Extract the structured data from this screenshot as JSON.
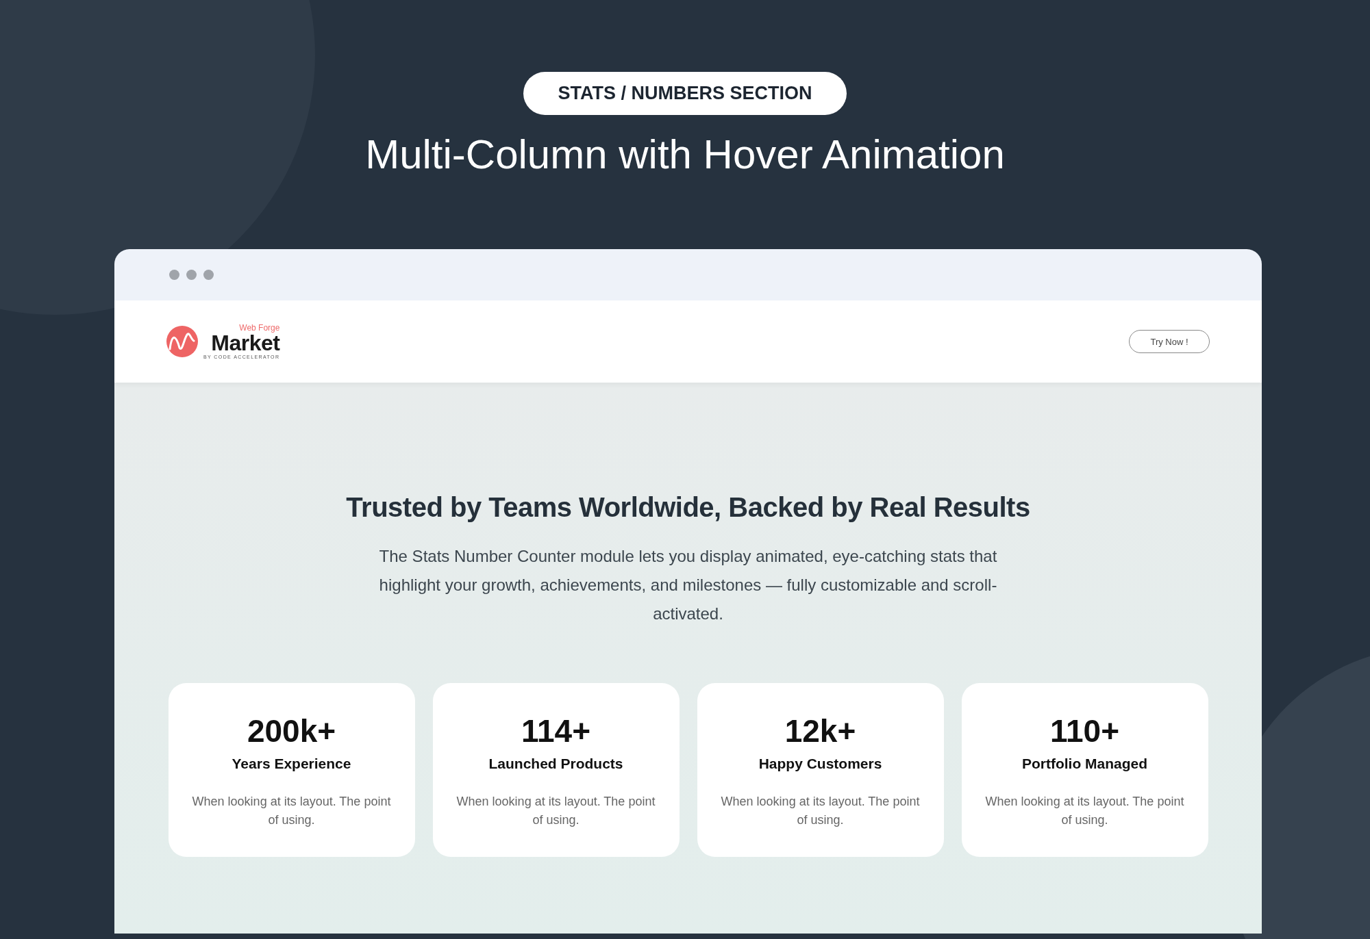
{
  "badge": "STATS / NUMBERS SECTION",
  "headline": "Multi-Column with Hover Animation",
  "browser": {
    "nav": {
      "logo": {
        "tagline": "Web Forge",
        "name": "Market",
        "byline": "BY CODE ACCELERATOR"
      },
      "button": "Try Now !"
    },
    "section": {
      "heading": "Trusted by Teams Worldwide, Backed by Real Results",
      "description": "The Stats Number Counter module lets you display animated, eye-catching stats that highlight your growth, achievements, and milestones — fully customizable and scroll-activated.",
      "stats": [
        {
          "value": "200k+",
          "label": "Years Experience",
          "text": "When looking at its layout. The point of using."
        },
        {
          "value": "114+",
          "label": "Launched Products",
          "text": "When looking at its layout. The point of using."
        },
        {
          "value": "12k+",
          "label": "Happy Customers",
          "text": "When looking at its layout. The point of using."
        },
        {
          "value": "110+",
          "label": "Portfolio Managed",
          "text": "When looking at its layout. The point of using."
        }
      ]
    }
  }
}
